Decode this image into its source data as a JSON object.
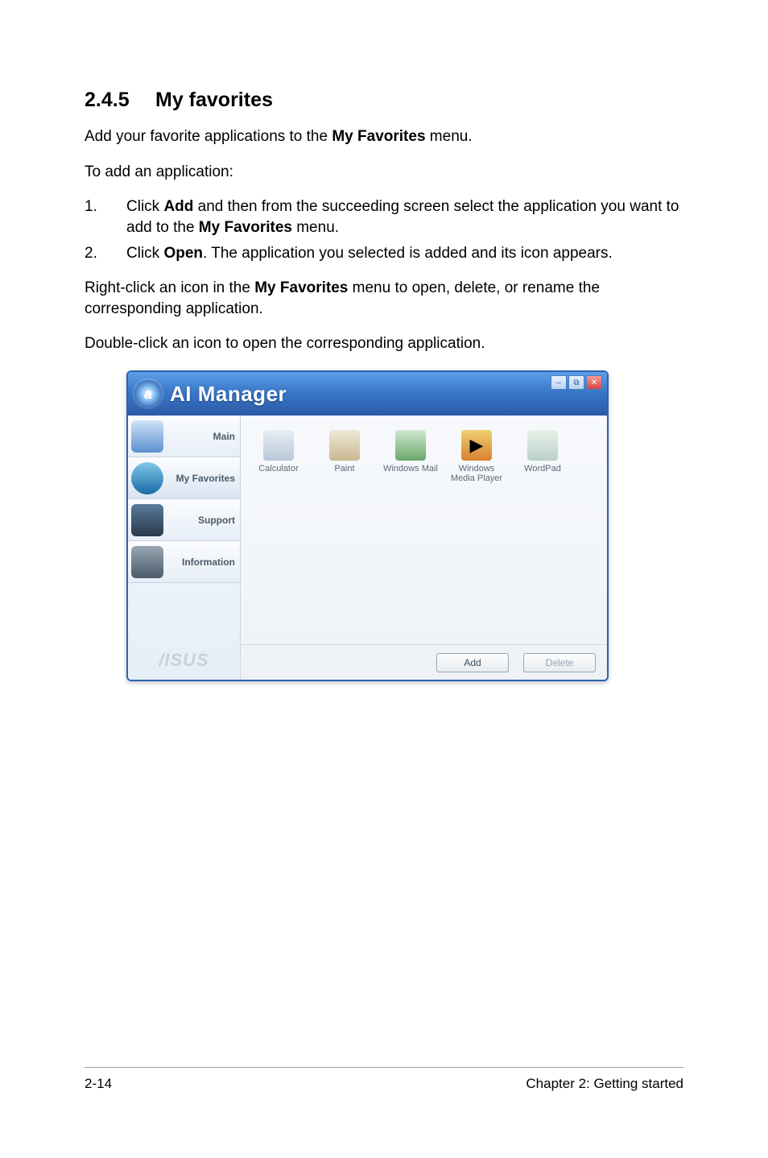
{
  "heading": {
    "number": "2.4.5",
    "title": "My favorites"
  },
  "intro": {
    "pre": "Add your favorite applications to the ",
    "b": "My Favorites",
    "post": " menu."
  },
  "lead": "To add an application:",
  "steps": [
    {
      "n": "1.",
      "pre": "Click ",
      "b1": "Add",
      "mid": " and then from the succeeding screen select the application you want to add to the ",
      "b2": "My Favorites",
      "post": " menu."
    },
    {
      "n": "2.",
      "pre": "Click ",
      "b1": "Open",
      "mid": ". The application you selected is added and its icon appears.",
      "b2": "",
      "post": ""
    }
  ],
  "para2": {
    "pre": "Right-click an icon in the ",
    "b": "My Favorites",
    "post": " menu to open, delete, or rename the corresponding application."
  },
  "para3": "Double-click an icon to open the corresponding application.",
  "window": {
    "title": "AI Manager",
    "sidebar": [
      {
        "label": "Main"
      },
      {
        "label": "My Favorites"
      },
      {
        "label": "Support"
      },
      {
        "label": "Information"
      }
    ],
    "brand": "/ISUS",
    "apps": [
      {
        "label": "Calculator"
      },
      {
        "label": "Paint"
      },
      {
        "label": "Windows Mail"
      },
      {
        "label": "Windows Media Player"
      },
      {
        "label": "WordPad"
      }
    ],
    "buttons": {
      "add": "Add",
      "delete": "Delete"
    }
  },
  "footer": {
    "left": "2-14",
    "right": "Chapter 2: Getting started"
  }
}
